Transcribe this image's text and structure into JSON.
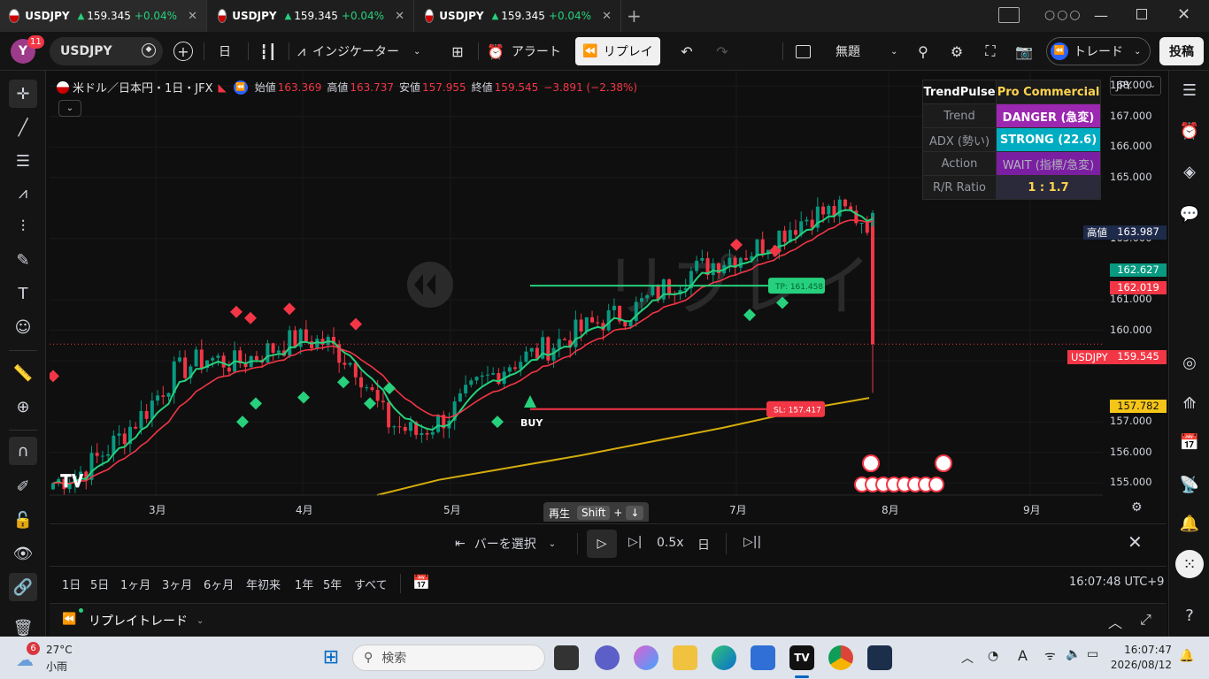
{
  "tabs": [
    {
      "symbol": "USDJPY",
      "price": "159.345",
      "change": "+0.04%"
    },
    {
      "symbol": "USDJPY",
      "price": "159.345",
      "change": "+0.04%"
    },
    {
      "symbol": "USDJPY",
      "price": "159.345",
      "change": "+0.04%"
    }
  ],
  "toolbar": {
    "avatar_letter": "Y",
    "notif_count": "11",
    "symbol": "USDJPY",
    "interval": "日",
    "indicators": "インジケーター",
    "alert": "アラート",
    "replay": "リプレイ",
    "layout_name": "無題",
    "trade": "トレード",
    "publish": "投稿"
  },
  "legend": {
    "title": "米ドル／日本円・1日・JFX",
    "open_label": "始値",
    "open": "163.369",
    "high_label": "高値",
    "high": "163.737",
    "low_label": "安値",
    "low": "157.955",
    "close_label": "終値",
    "close": "159.545",
    "change": "−3.891 (−2.38%)"
  },
  "watermark": "リプレイ",
  "trendpulse": {
    "header": [
      "TrendPulse",
      "Pro Commercial"
    ],
    "rows": [
      {
        "label": "Trend",
        "value": "DANGER (急変)"
      },
      {
        "label": "ADX (勢い)",
        "value": "STRONG (22.6)"
      },
      {
        "label": "Action",
        "value": "WAIT (指標/急変)"
      },
      {
        "label": "R/R Ratio",
        "value": "1 : 1.7"
      }
    ],
    "colors": {
      "danger": "#9c27b0",
      "strong": "#00acc1",
      "wait": "#7b1fa2",
      "ratio": "#ffd54f"
    }
  },
  "price_axis": {
    "currency": "JPY",
    "ticks": [
      "168.000",
      "167.000",
      "166.000",
      "165.000",
      "163.000",
      "161.000",
      "160.000",
      "159.000",
      "157.000",
      "156.000",
      "155.000"
    ],
    "high_label": "高値",
    "high_value": "163.987",
    "ema_fast": "162.627",
    "ema_slow": "162.019",
    "current_symbol": "USDJPY",
    "current": "159.545",
    "sma_long": "157.782"
  },
  "time_axis": [
    "3月",
    "4月",
    "5月",
    "7月",
    "8月",
    "9月"
  ],
  "annotations": {
    "tp": "TP: 161.458",
    "sl": "SL: 157.417",
    "buy": "BUY"
  },
  "replay_controls": {
    "tooltip": "再生",
    "shortcut1": "Shift",
    "plus": "+",
    "shortcut2": "↓",
    "select_bar": "バーを選択",
    "speed": "0.5x",
    "interval": "日"
  },
  "ranges": [
    "1日",
    "5日",
    "1ヶ月",
    "3ヶ月",
    "6ヶ月",
    "年初来",
    "1年",
    "5年",
    "すべて"
  ],
  "clock": "16:07:48 UTC+9",
  "bottom_panel": {
    "title": "リプレイトレード"
  },
  "taskbar": {
    "weather_temp": "27°C",
    "weather_desc": "小雨",
    "weather_badge": "6",
    "search": "検索",
    "time": "16:07:47",
    "date": "2026/08/12"
  },
  "chart_data": {
    "type": "candlestick",
    "x": [
      "3月",
      "4月",
      "5月",
      "7月",
      "8月"
    ],
    "ylim": [
      154.6,
      168.5
    ],
    "series": [
      {
        "name": "USDJPY",
        "values": [
          155.0,
          155.4,
          156.3,
          157.3,
          158.6,
          159.1,
          158.9,
          159.3,
          159.7,
          159.6,
          158.8,
          157.0,
          156.6,
          157.2,
          158.2,
          158.9,
          159.3,
          159.8,
          160.3,
          160.6,
          161.3,
          161.9,
          162.3,
          162.6,
          163.2,
          163.8,
          163.9,
          163.5,
          159.545
        ]
      }
    ]
  }
}
